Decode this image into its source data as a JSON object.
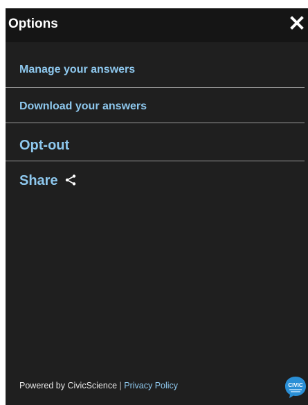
{
  "header": {
    "title": "Options"
  },
  "menu": {
    "items": [
      {
        "label": "Manage your answers"
      },
      {
        "label": "Download your answers"
      },
      {
        "label": "Opt-out"
      },
      {
        "label": "Share"
      }
    ]
  },
  "footer": {
    "powered_by": "Powered by CivicScience",
    "separator": "|",
    "privacy_link": "Privacy Policy",
    "logo_text": "CIVIC"
  },
  "icons": {
    "close": "close-icon",
    "share": "share-icon",
    "logo": "civicscience-logo-icon"
  },
  "colors": {
    "panel_background": "#1f1f1f",
    "header_background": "#151515",
    "link": "#8ec8ee",
    "divider": "#9a9a9a",
    "logo": "#2a8fd6"
  }
}
